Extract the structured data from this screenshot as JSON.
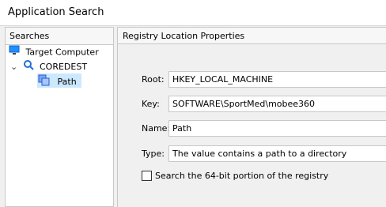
{
  "window": {
    "title": "Application Search"
  },
  "searches": {
    "header": "Searches",
    "items": [
      {
        "label": "Target Computer",
        "icon": "monitor-icon"
      },
      {
        "label": "COREDEST",
        "icon": "search-icon"
      },
      {
        "label": "Path",
        "icon": "registry-icon"
      }
    ]
  },
  "properties": {
    "header": "Registry Location Properties",
    "root_label": "Root:",
    "root_value": "HKEY_LOCAL_MACHINE",
    "key_label": "Key:",
    "key_value": "SOFTWARE\\SportMed\\mobee360",
    "name_label": "Name:",
    "name_value": "Path",
    "type_label": "Type:",
    "type_value": "The value contains a path to a directory",
    "checkbox_label": "Search the 64-bit portion of the registry"
  }
}
